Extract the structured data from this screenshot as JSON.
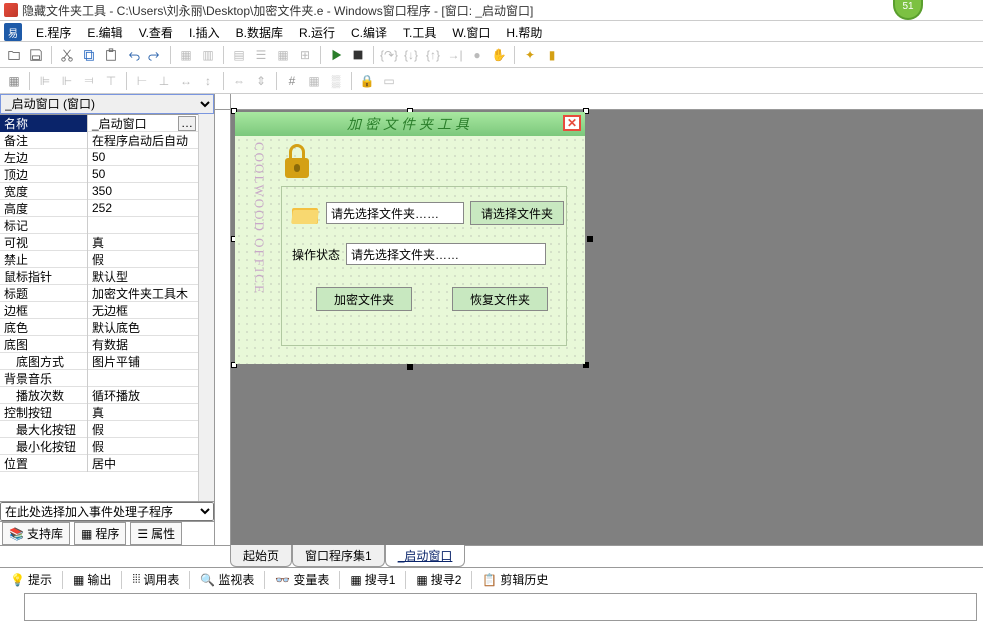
{
  "badge": "51",
  "title": "隐藏文件夹工具 - C:\\Users\\刘永丽\\Desktop\\加密文件夹.e - Windows窗口程序 - [窗口: _启动窗口]",
  "menu": [
    "E.程序",
    "E.编辑",
    "V.查看",
    "I.插入",
    "B.数据库",
    "R.运行",
    "C.编译",
    "T.工具",
    "W.窗口",
    "H.帮助"
  ],
  "object_selector": "_启动窗口 (窗口)",
  "properties": [
    {
      "name": "名称",
      "value": "_启动窗口",
      "selected": true,
      "ellipsis": true
    },
    {
      "name": "备注",
      "value": "在程序启动后自动"
    },
    {
      "name": "左边",
      "value": "50"
    },
    {
      "name": "顶边",
      "value": "50"
    },
    {
      "name": "宽度",
      "value": "350"
    },
    {
      "name": "高度",
      "value": "252"
    },
    {
      "name": "标记",
      "value": ""
    },
    {
      "name": "可视",
      "value": "真"
    },
    {
      "name": "禁止",
      "value": "假"
    },
    {
      "name": "鼠标指针",
      "value": "默认型"
    },
    {
      "name": "标题",
      "value": "加密文件夹工具木"
    },
    {
      "name": "边框",
      "value": "无边框"
    },
    {
      "name": "底色",
      "value": "默认底色"
    },
    {
      "name": "底图",
      "value": "有数据"
    },
    {
      "name": "底图方式",
      "value": "图片平铺",
      "indent": true
    },
    {
      "name": "背景音乐",
      "value": ""
    },
    {
      "name": "播放次数",
      "value": "循环播放",
      "indent": true
    },
    {
      "name": "控制按钮",
      "value": "真"
    },
    {
      "name": "最大化按钮",
      "value": "假",
      "indent": true
    },
    {
      "name": "最小化按钮",
      "value": "假",
      "indent": true
    },
    {
      "name": "位置",
      "value": "居中"
    }
  ],
  "event_selector": "在此处选择加入事件处理子程序",
  "left_buttons": {
    "lib": "支持库",
    "prog": "程序",
    "attr": "属性"
  },
  "form": {
    "title": "加密文件夹工具",
    "placeholder1": "请先选择文件夹……",
    "btn_select": "请选择文件夹",
    "status_label": "操作状态",
    "status_text": "请先选择文件夹……",
    "btn_encrypt": "加密文件夹",
    "btn_restore": "恢复文件夹"
  },
  "tabs": {
    "start": "起始页",
    "set": "窗口程序集1",
    "win": "_启动窗口"
  },
  "output_buttons": {
    "tip": "提示",
    "out": "输出",
    "dbg": "调用表",
    "watch": "监视表",
    "var": "变量表",
    "s1": "搜寻1",
    "s2": "搜寻2",
    "clip": "剪辑历史"
  }
}
